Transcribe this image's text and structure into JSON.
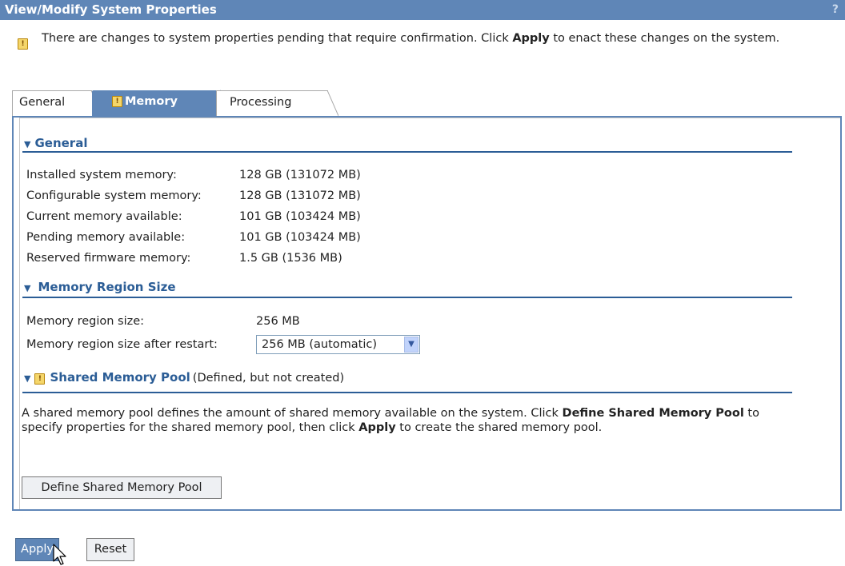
{
  "window": {
    "title": "View/Modify System Properties",
    "help_label": "?"
  },
  "pending": {
    "prefix": "There are changes to system properties pending that require confirmation. Click ",
    "bold": "Apply",
    "suffix": " to enact these changes on the system."
  },
  "tabs": [
    {
      "label": "General"
    },
    {
      "label": "Memory",
      "selected": true
    },
    {
      "label": "Processing"
    }
  ],
  "sections": {
    "general": {
      "title": "General",
      "rows": [
        {
          "label": "Installed system memory:",
          "value": "128 GB (131072 MB)"
        },
        {
          "label": "Configurable system memory:",
          "value": "128 GB (131072 MB)"
        },
        {
          "label": "Current memory available:",
          "value": "101 GB (103424 MB)"
        },
        {
          "label": "Pending memory available:",
          "value": "101 GB (103424 MB)"
        },
        {
          "label": "Reserved firmware memory:",
          "value": "1.5 GB (1536 MB)"
        }
      ]
    },
    "region": {
      "title": "Memory Region Size",
      "size_label": "Memory region size:",
      "size_value": "256 MB",
      "restart_label": "Memory region size after restart:",
      "restart_value": "256 MB (automatic)"
    },
    "shared": {
      "title": "Shared Memory Pool",
      "status": "(Defined, but not created)",
      "desc_1": "A shared memory pool defines the amount of shared memory available on the system. Click ",
      "desc_bold_1": "Define Shared Memory Pool",
      "desc_2": " to specify properties for the shared memory pool, then click ",
      "desc_bold_2": "Apply",
      "desc_3": " to create the shared memory pool.",
      "define_button": "Define Shared Memory Pool"
    }
  },
  "footer": {
    "apply": "Apply",
    "reset": "Reset"
  },
  "colors": {
    "titlebar": "#5f86b7",
    "section_heading": "#2b5d96",
    "warning": "#f5d66a"
  },
  "icons": [
    "warning-icon",
    "help-icon",
    "collapse-triangle-icon",
    "dropdown-arrow-icon",
    "mouse-cursor-icon"
  ]
}
